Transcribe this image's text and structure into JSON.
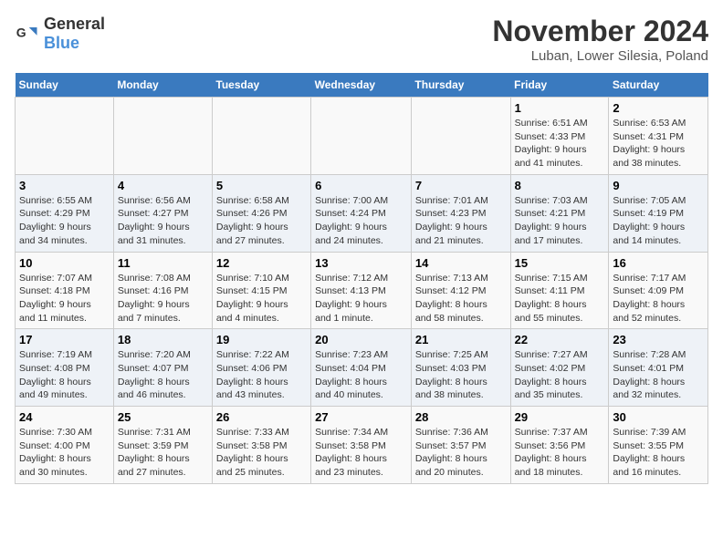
{
  "logo": {
    "general": "General",
    "blue": "Blue"
  },
  "title": "November 2024",
  "location": "Luban, Lower Silesia, Poland",
  "days_of_week": [
    "Sunday",
    "Monday",
    "Tuesday",
    "Wednesday",
    "Thursday",
    "Friday",
    "Saturday"
  ],
  "weeks": [
    [
      {
        "day": "",
        "info": ""
      },
      {
        "day": "",
        "info": ""
      },
      {
        "day": "",
        "info": ""
      },
      {
        "day": "",
        "info": ""
      },
      {
        "day": "",
        "info": ""
      },
      {
        "day": "1",
        "info": "Sunrise: 6:51 AM\nSunset: 4:33 PM\nDaylight: 9 hours\nand 41 minutes."
      },
      {
        "day": "2",
        "info": "Sunrise: 6:53 AM\nSunset: 4:31 PM\nDaylight: 9 hours\nand 38 minutes."
      }
    ],
    [
      {
        "day": "3",
        "info": "Sunrise: 6:55 AM\nSunset: 4:29 PM\nDaylight: 9 hours\nand 34 minutes."
      },
      {
        "day": "4",
        "info": "Sunrise: 6:56 AM\nSunset: 4:27 PM\nDaylight: 9 hours\nand 31 minutes."
      },
      {
        "day": "5",
        "info": "Sunrise: 6:58 AM\nSunset: 4:26 PM\nDaylight: 9 hours\nand 27 minutes."
      },
      {
        "day": "6",
        "info": "Sunrise: 7:00 AM\nSunset: 4:24 PM\nDaylight: 9 hours\nand 24 minutes."
      },
      {
        "day": "7",
        "info": "Sunrise: 7:01 AM\nSunset: 4:23 PM\nDaylight: 9 hours\nand 21 minutes."
      },
      {
        "day": "8",
        "info": "Sunrise: 7:03 AM\nSunset: 4:21 PM\nDaylight: 9 hours\nand 17 minutes."
      },
      {
        "day": "9",
        "info": "Sunrise: 7:05 AM\nSunset: 4:19 PM\nDaylight: 9 hours\nand 14 minutes."
      }
    ],
    [
      {
        "day": "10",
        "info": "Sunrise: 7:07 AM\nSunset: 4:18 PM\nDaylight: 9 hours\nand 11 minutes."
      },
      {
        "day": "11",
        "info": "Sunrise: 7:08 AM\nSunset: 4:16 PM\nDaylight: 9 hours\nand 7 minutes."
      },
      {
        "day": "12",
        "info": "Sunrise: 7:10 AM\nSunset: 4:15 PM\nDaylight: 9 hours\nand 4 minutes."
      },
      {
        "day": "13",
        "info": "Sunrise: 7:12 AM\nSunset: 4:13 PM\nDaylight: 9 hours\nand 1 minute."
      },
      {
        "day": "14",
        "info": "Sunrise: 7:13 AM\nSunset: 4:12 PM\nDaylight: 8 hours\nand 58 minutes."
      },
      {
        "day": "15",
        "info": "Sunrise: 7:15 AM\nSunset: 4:11 PM\nDaylight: 8 hours\nand 55 minutes."
      },
      {
        "day": "16",
        "info": "Sunrise: 7:17 AM\nSunset: 4:09 PM\nDaylight: 8 hours\nand 52 minutes."
      }
    ],
    [
      {
        "day": "17",
        "info": "Sunrise: 7:19 AM\nSunset: 4:08 PM\nDaylight: 8 hours\nand 49 minutes."
      },
      {
        "day": "18",
        "info": "Sunrise: 7:20 AM\nSunset: 4:07 PM\nDaylight: 8 hours\nand 46 minutes."
      },
      {
        "day": "19",
        "info": "Sunrise: 7:22 AM\nSunset: 4:06 PM\nDaylight: 8 hours\nand 43 minutes."
      },
      {
        "day": "20",
        "info": "Sunrise: 7:23 AM\nSunset: 4:04 PM\nDaylight: 8 hours\nand 40 minutes."
      },
      {
        "day": "21",
        "info": "Sunrise: 7:25 AM\nSunset: 4:03 PM\nDaylight: 8 hours\nand 38 minutes."
      },
      {
        "day": "22",
        "info": "Sunrise: 7:27 AM\nSunset: 4:02 PM\nDaylight: 8 hours\nand 35 minutes."
      },
      {
        "day": "23",
        "info": "Sunrise: 7:28 AM\nSunset: 4:01 PM\nDaylight: 8 hours\nand 32 minutes."
      }
    ],
    [
      {
        "day": "24",
        "info": "Sunrise: 7:30 AM\nSunset: 4:00 PM\nDaylight: 8 hours\nand 30 minutes."
      },
      {
        "day": "25",
        "info": "Sunrise: 7:31 AM\nSunset: 3:59 PM\nDaylight: 8 hours\nand 27 minutes."
      },
      {
        "day": "26",
        "info": "Sunrise: 7:33 AM\nSunset: 3:58 PM\nDaylight: 8 hours\nand 25 minutes."
      },
      {
        "day": "27",
        "info": "Sunrise: 7:34 AM\nSunset: 3:58 PM\nDaylight: 8 hours\nand 23 minutes."
      },
      {
        "day": "28",
        "info": "Sunrise: 7:36 AM\nSunset: 3:57 PM\nDaylight: 8 hours\nand 20 minutes."
      },
      {
        "day": "29",
        "info": "Sunrise: 7:37 AM\nSunset: 3:56 PM\nDaylight: 8 hours\nand 18 minutes."
      },
      {
        "day": "30",
        "info": "Sunrise: 7:39 AM\nSunset: 3:55 PM\nDaylight: 8 hours\nand 16 minutes."
      }
    ]
  ]
}
